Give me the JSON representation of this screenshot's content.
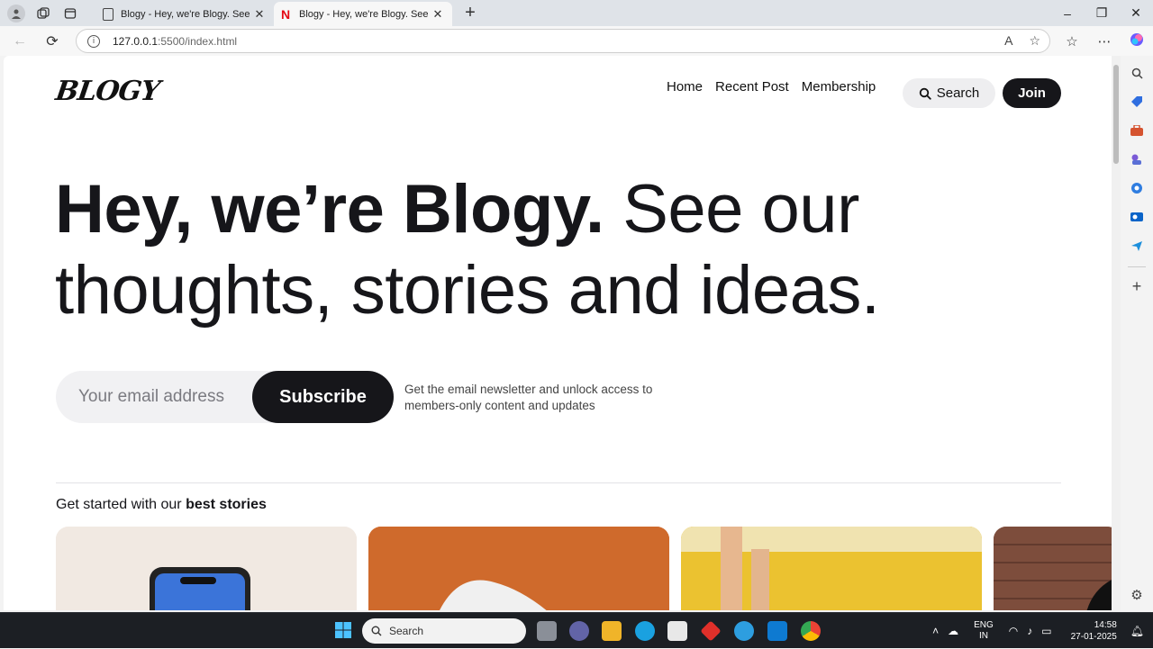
{
  "browser": {
    "tabs": [
      {
        "title": "Blogy - Hey, we're Blogy. See our",
        "active": false,
        "favicon": "page-icon"
      },
      {
        "title": "Blogy - Hey, we're Blogy. See our",
        "active": true,
        "favicon": "netflix-n-icon"
      }
    ],
    "url_host": "127.0.0.1",
    "url_path": ":5500/index.html"
  },
  "site": {
    "logo": "BLOGY",
    "nav": {
      "home": "Home",
      "recent_post": "Recent Post",
      "membership": "Membership",
      "search": "Search",
      "join": "Join"
    },
    "hero": {
      "bold": "Hey, we’re Blogy.",
      "light": "See our thoughts, stories and ideas."
    },
    "subscribe": {
      "placeholder": "Your email address",
      "button": "Subscribe",
      "note": "Get the email newsletter and unlock access to members-only content and updates"
    },
    "stories": {
      "prefix": "Get started with our",
      "emphasis": "best stories"
    }
  },
  "taskbar": {
    "search_placeholder": "Search",
    "lang_top": "ENG",
    "lang_bottom": "IN",
    "time": "14:58",
    "date": "27-01-2025"
  },
  "colors": {
    "dark": "#16161a",
    "accent_card1": "#efe7df",
    "accent_card2": "#cf6a2c",
    "accent_card3": "#ecc23a",
    "accent_card4": "#7a4a3a"
  }
}
